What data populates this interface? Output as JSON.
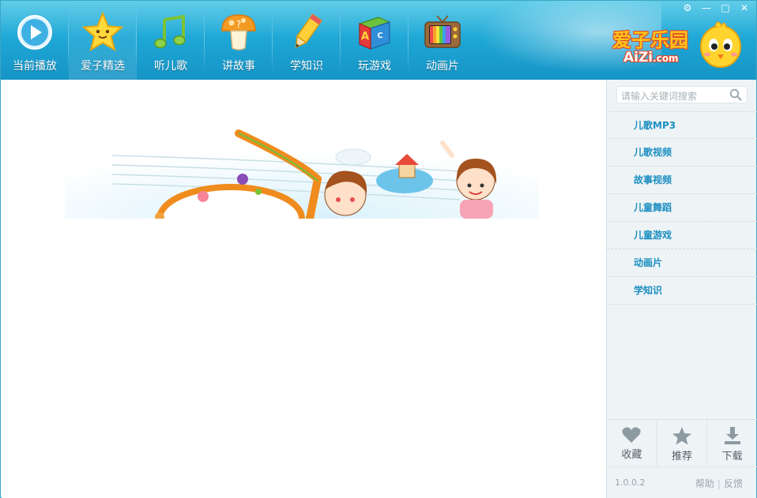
{
  "window": {
    "controls": {
      "settings": "⚙",
      "minimize": "—",
      "maximize": "□",
      "close": "✕"
    }
  },
  "nav": {
    "items": [
      {
        "label": "当前播放",
        "icon": "play-icon"
      },
      {
        "label": "爱子精选",
        "icon": "star-icon"
      },
      {
        "label": "听儿歌",
        "icon": "music-note-icon"
      },
      {
        "label": "讲故事",
        "icon": "mushroom-icon"
      },
      {
        "label": "学知识",
        "icon": "pencil-icon"
      },
      {
        "label": "玩游戏",
        "icon": "toy-block-icon"
      },
      {
        "label": "动画片",
        "icon": "tv-icon"
      }
    ]
  },
  "logo": {
    "title": "爱子乐园",
    "domain_main": "AiZi",
    "domain_suffix": ".com"
  },
  "sidebar": {
    "search_placeholder": "请输入关键词搜索",
    "categories": [
      "儿歌MP3",
      "儿歌视频",
      "故事视频",
      "儿童舞蹈",
      "儿童游戏",
      "动画片",
      "学知识"
    ],
    "actions": [
      {
        "label": "收藏",
        "icon": "heart-icon"
      },
      {
        "label": "推荐",
        "icon": "star-outline-icon"
      },
      {
        "label": "下载",
        "icon": "download-icon"
      }
    ],
    "version": "1.0.0.2",
    "help": "帮助",
    "feedback": "反馈"
  },
  "colors": {
    "toolbar": "#1fa8d6",
    "category_text": "#1a8ec0",
    "sidebar_bg": "#eef3f6"
  }
}
